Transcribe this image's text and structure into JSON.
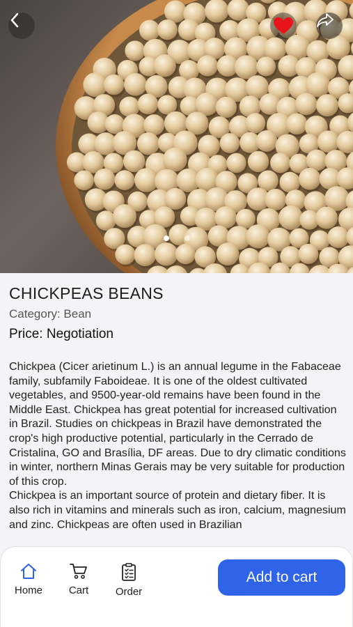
{
  "product": {
    "title": "CHICKPEAS BEANS",
    "category": "Category: Bean",
    "price": "Price: Negotiation",
    "description": "Chickpea (Cicer arietinum L.) is an annual legume in the Fabaceae family, subfamily Faboideae. It is one of the oldest cultivated vegetables, and 9500-year-old remains have been found in the Middle East. Chickpea has great potential for increased cultivation in Brazil. Studies on chickpeas in Brazil have demonstrated the crop's high productive potential, particularly in the Cerrado de Cristalina, GO and Brasília, DF areas. Due to dry climatic conditions in winter, northern Minas Gerais may be very suitable for production of this crop.\nChickpea is an important source of protein and dietary fiber. It is also rich in vitamins and minerals such as iron, calcium, magnesium and zinc. Chickpeas are often used in Brazilian"
  },
  "hero": {
    "icons": {
      "back": "chevron-left-icon",
      "favorite": "heart-icon",
      "share": "share-icon"
    },
    "favorite_color": "#e8141b",
    "carousel_count": 2,
    "carousel_active": 1
  },
  "bottom_nav": {
    "items": [
      {
        "label": "Home",
        "icon": "home-icon",
        "active": true
      },
      {
        "label": "Cart",
        "icon": "cart-icon",
        "active": false
      },
      {
        "label": "Order",
        "icon": "clipboard-icon",
        "active": false
      }
    ],
    "add_to_cart": "Add to cart",
    "accent_color": "#2f64e8"
  }
}
